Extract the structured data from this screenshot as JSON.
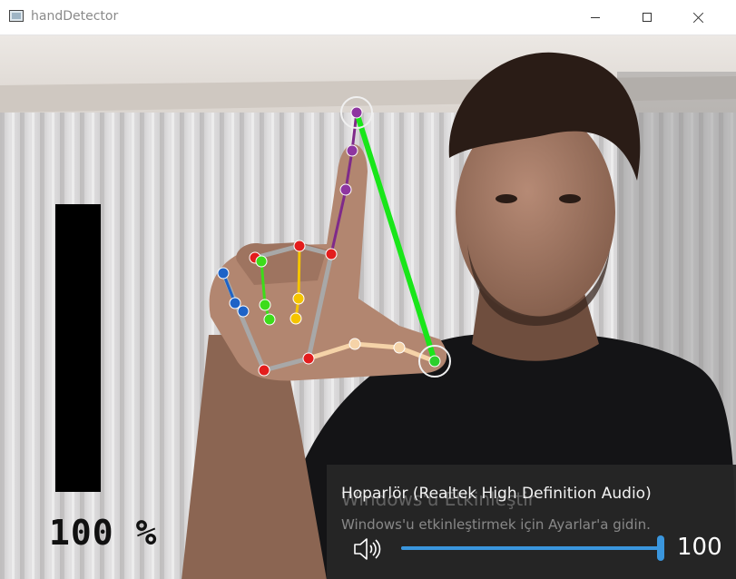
{
  "window": {
    "title": "handDetector",
    "icon": "app-window-icon",
    "controls": [
      "minimize",
      "maximize",
      "close"
    ]
  },
  "overlay": {
    "volume_percent_text": "100 %",
    "volume_level": 1.0,
    "bar_color": "#000000"
  },
  "volume_flyout": {
    "device_name": "Hoparlör (Realtek High Definition Audio)",
    "watermark_title": "Windows'u Etkinleştir",
    "watermark_subtitle": "Windows'u etkinleştirmek için Ayarlar'a gidin.",
    "speaker_icon": "speaker-volume-icon",
    "slider_value": 100,
    "slider_level": 1.0,
    "volume_value": "100",
    "accent_color": "#3a96dd"
  }
}
